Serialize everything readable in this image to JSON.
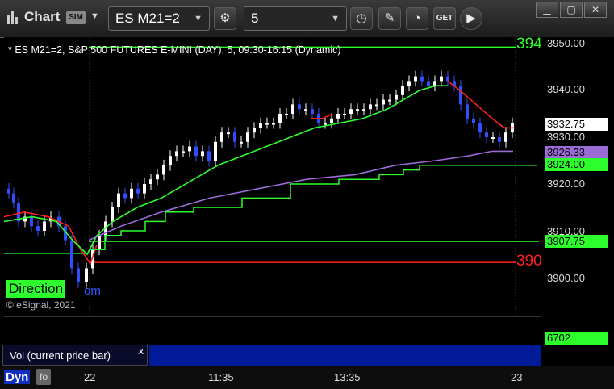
{
  "toolbar": {
    "app_title": "Chart",
    "sim_badge": "SIM",
    "symbol": "ES M21=2",
    "interval": "5"
  },
  "chart_info": {
    "description": "* ES M21=2, S&P 500 FUTURES E-MINI (DAY), 5, 09:30-16:15 (Dynamic)",
    "copyright": "© eSignal, 2021",
    "direction_label": "Direction",
    "direction_suffix": "om"
  },
  "right_axis": {
    "ticks": [
      "3950.00",
      "3940.00",
      "3930.00",
      "3920.00",
      "3910.00",
      "3900.00"
    ],
    "tags": {
      "last_price": "3932.75",
      "purple_ma": "3926.33",
      "green_level_top": "3924.00",
      "green_level_low": "3907.75"
    },
    "edge_labels": {
      "green_edge": "394",
      "red_edge": "390"
    },
    "volume_value": "6702"
  },
  "x_axis": {
    "ticks": [
      "22",
      "11:35",
      "13:35",
      "23"
    ]
  },
  "volume_panel": {
    "label": "Vol (current price bar)",
    "close_symbol": "x"
  },
  "bottom_bar": {
    "dyn_label": "Dyn",
    "icon_text": "fo"
  },
  "chart_data": {
    "type": "line",
    "ylim": [
      3896,
      3952
    ],
    "horizontal_levels": [
      {
        "name": "green-top",
        "value": 3949.25,
        "color": "#2cff2c"
      },
      {
        "name": "green-mid",
        "value": 3924.0,
        "color": "#2cff2c"
      },
      {
        "name": "green-low",
        "value": 3907.75,
        "color": "#2cff2c"
      },
      {
        "name": "red-level",
        "value": 3903.25,
        "color": "#ff2020"
      }
    ],
    "colors": {
      "up_candle": "#ffffff",
      "down_candle": "#2f4fff",
      "green_ma": "#2cff2c",
      "red_ma": "#ff2020",
      "purple_ma": "#9b6bd6",
      "volume": "#ff3030"
    }
  }
}
